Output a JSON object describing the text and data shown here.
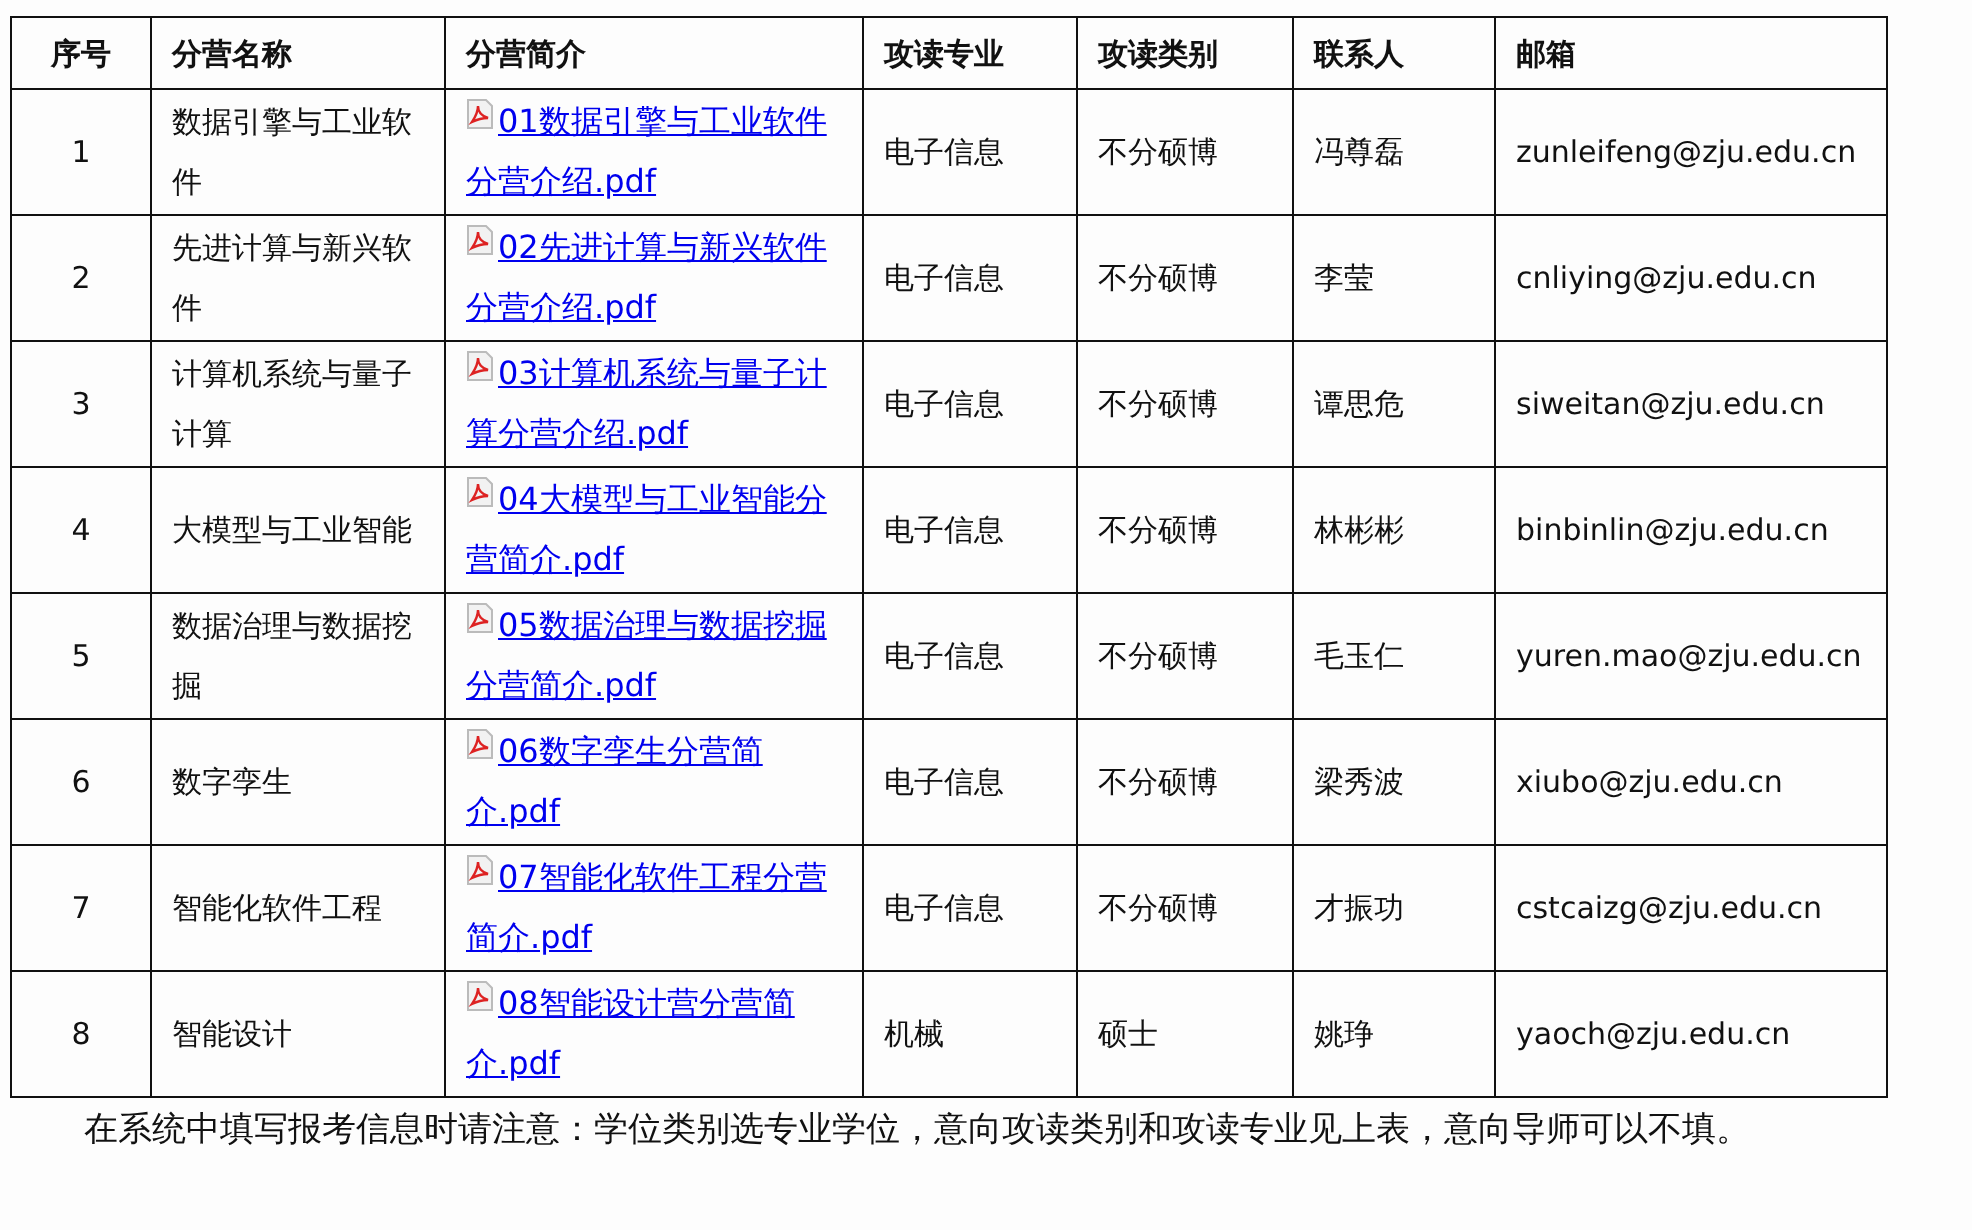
{
  "table": {
    "columns": [
      "序号",
      "分营名称",
      "分营简介",
      "攻读专业",
      "攻读类别",
      "联系人",
      "邮箱"
    ],
    "rows": [
      {
        "no": "1",
        "name": "数据引擎与工业软件",
        "intro": "01数据引擎与工业软件分营介绍.pdf",
        "major": "电子信息",
        "category": "不分硕博",
        "contact": "冯尊磊",
        "email": "zunleifeng@zju.edu.cn"
      },
      {
        "no": "2",
        "name": "先进计算与新兴软件",
        "intro": "02先进计算与新兴软件分营介绍.pdf",
        "major": "电子信息",
        "category": "不分硕博",
        "contact": "李莹",
        "email": "cnliying@zju.edu.cn"
      },
      {
        "no": "3",
        "name": "计算机系统与量子计算",
        "intro": "03计算机系统与量子计算分营介绍.pdf",
        "major": "电子信息",
        "category": "不分硕博",
        "contact": "谭思危",
        "email": "siweitan@zju.edu.cn"
      },
      {
        "no": "4",
        "name": "大模型与工业智能",
        "intro": "04大模型与工业智能分营简介.pdf",
        "major": "电子信息",
        "category": "不分硕博",
        "contact": "林彬彬",
        "email": "binbinlin@zju.edu.cn"
      },
      {
        "no": "5",
        "name": "数据治理与数据挖掘",
        "intro": "05数据治理与数据挖掘分营简介.pdf",
        "major": "电子信息",
        "category": "不分硕博",
        "contact": "毛玉仁",
        "email": "yuren.mao@zju.edu.cn"
      },
      {
        "no": "6",
        "name": "数字孪生",
        "intro": "06数字孪生分营简介.pdf",
        "major": "电子信息",
        "category": "不分硕博",
        "contact": "梁秀波",
        "email": "xiubo@zju.edu.cn"
      },
      {
        "no": "7",
        "name": "智能化软件工程",
        "intro": "07智能化软件工程分营简介.pdf",
        "major": "电子信息",
        "category": "不分硕博",
        "contact": "才振功",
        "email": "cstcaizg@zju.edu.cn"
      },
      {
        "no": "8",
        "name": "智能设计",
        "intro": "08智能设计营分营简介.pdf",
        "major": "机械",
        "category": "硕士",
        "contact": "姚琤",
        "email": "yaoch@zju.edu.cn"
      }
    ]
  },
  "note": "在系统中填写报考信息时请注意：学位类别选专业学位，意向攻读类别和攻读专业见上表，意向导师可以不填。"
}
